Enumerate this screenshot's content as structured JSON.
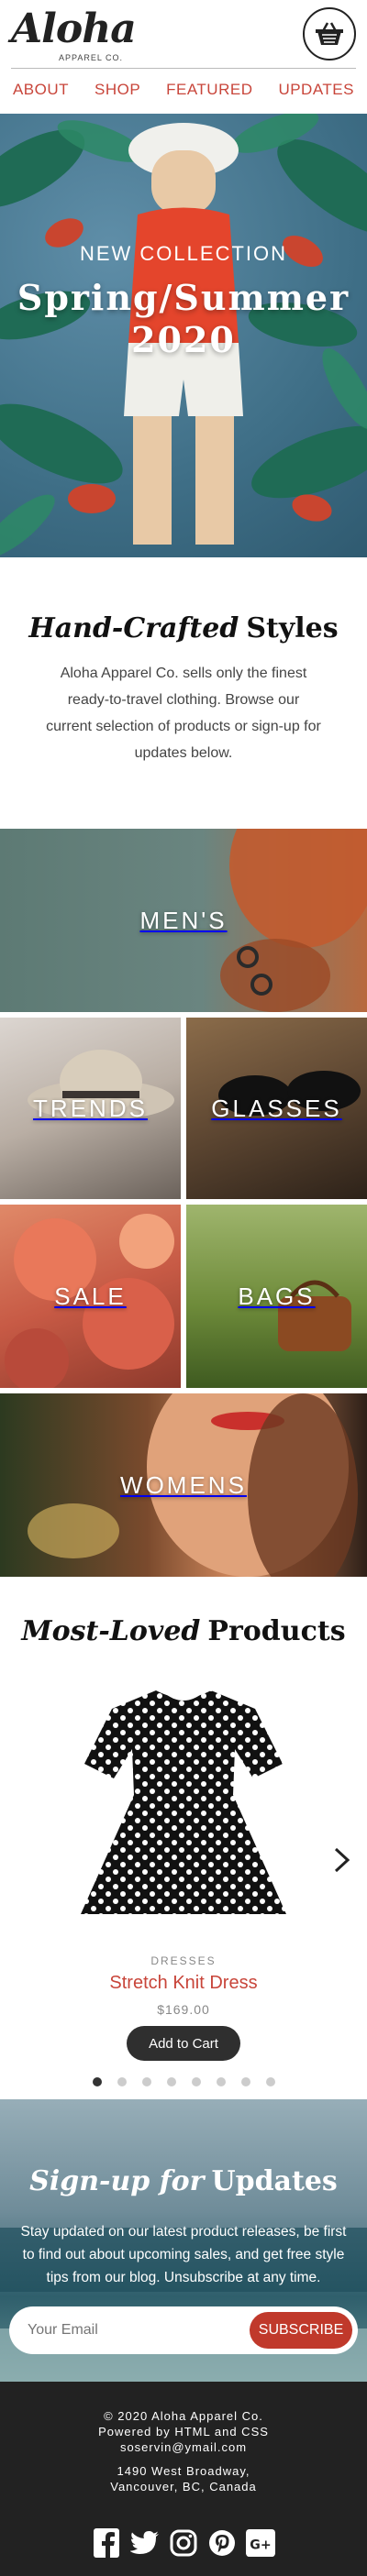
{
  "brand": {
    "name": "Aloha",
    "subtitle": "APPAREL CO."
  },
  "nav": {
    "items": [
      "ABOUT",
      "SHOP",
      "FEATURED",
      "UPDATES"
    ]
  },
  "hero": {
    "kicker": "NEW COLLECTION",
    "title_line1": "Spring/Summer",
    "title_line2": "2020"
  },
  "intro": {
    "heading_italic": "Hand-Crafted",
    "heading_bold": "Styles",
    "body": "Aloha Apparel Co. sells only the finest ready-to-travel clothing. Browse our current selection of products or sign-up for updates below."
  },
  "categories": [
    "MEN'S",
    "TRENDS",
    "GLASSES",
    "SALE",
    "BAGS",
    "WOMENS"
  ],
  "products": {
    "heading_italic": "Most-Loved",
    "heading_bold": "Products",
    "category": "DRESSES",
    "name": "Stretch Knit Dress",
    "price": "$169.00",
    "add_to_cart": "Add to Cart",
    "carousel_dot_count": 8,
    "active_dot_index": 0
  },
  "signup": {
    "heading_italic": "Sign-up for",
    "heading_bold": "Updates",
    "body": "Stay updated on our latest product releases, be first to find out about upcoming sales, and get free style tips from our blog. Unsubscribe at any time.",
    "email_placeholder": "Your Email",
    "subscribe_label": "SUBSCRIBE"
  },
  "footer": {
    "copyright": "© 2020 Aloha Apparel Co.",
    "powered": "Powered by HTML and CSS",
    "email": "soservin@ymail.com",
    "address_line1": "1490 West Broadway,",
    "address_line2": "Vancouver, BC, Canada",
    "socials": [
      "facebook-icon",
      "twitter-icon",
      "instagram-icon",
      "pinterest-icon",
      "google-plus-icon"
    ]
  },
  "colors": {
    "accent": "#c8453a",
    "subscribe": "#c0392b",
    "footer_bg": "#222222",
    "button_dark": "#2f2f2f"
  }
}
